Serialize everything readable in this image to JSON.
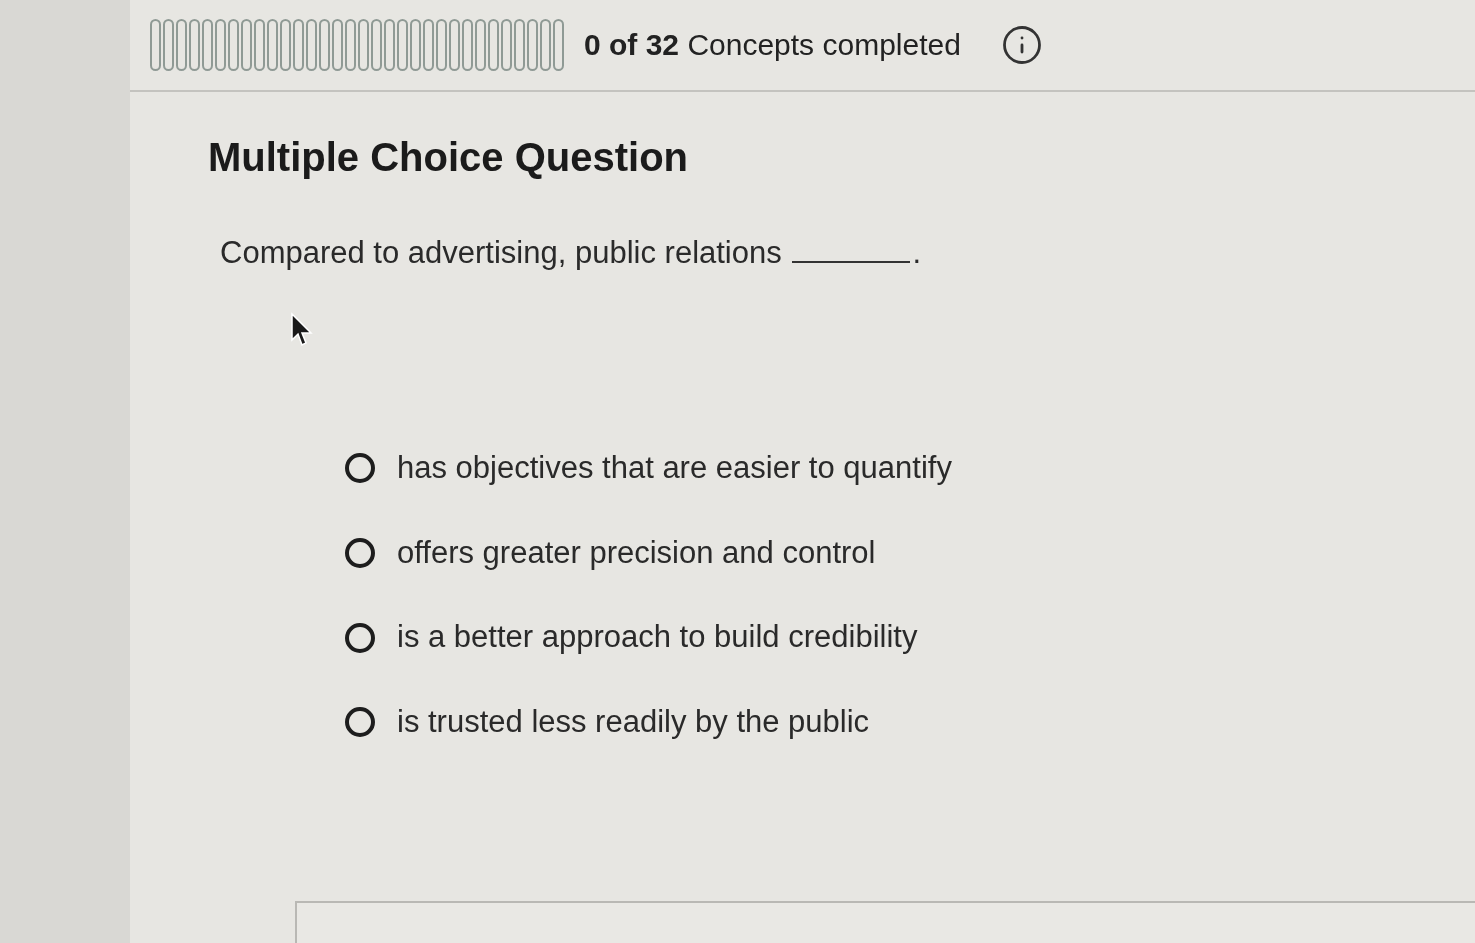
{
  "progress": {
    "segments": [
      {
        "completed": false
      },
      {
        "completed": false
      },
      {
        "completed": false
      },
      {
        "completed": false
      },
      {
        "completed": false
      },
      {
        "completed": false
      },
      {
        "completed": false
      },
      {
        "completed": false
      },
      {
        "completed": false
      },
      {
        "completed": false
      },
      {
        "completed": false
      },
      {
        "completed": false
      },
      {
        "completed": false
      },
      {
        "completed": false
      },
      {
        "completed": false
      },
      {
        "completed": false
      },
      {
        "completed": false
      },
      {
        "completed": false
      },
      {
        "completed": false
      },
      {
        "completed": false
      },
      {
        "completed": false
      },
      {
        "completed": false
      },
      {
        "completed": false
      },
      {
        "completed": false
      },
      {
        "completed": false
      },
      {
        "completed": false
      },
      {
        "completed": false
      },
      {
        "completed": false
      },
      {
        "completed": false
      },
      {
        "completed": false
      },
      {
        "completed": false
      },
      {
        "completed": false
      }
    ],
    "label": "**0 of 32** Concepts completed"
  },
  "question": {
    "heading": "Multiple Choice Question",
    "prompt_before": "Compared to advertising, public relations",
    "prompt_after": "."
  },
  "options": [
    {
      "label": "has objectives that are easier to quantify",
      "selected": false
    },
    {
      "label": "offers greater precision and control",
      "selected": false
    },
    {
      "label": "is a better approach to build credibility",
      "selected": false
    },
    {
      "label": "is trusted less readily by the public",
      "selected": false
    }
  ]
}
